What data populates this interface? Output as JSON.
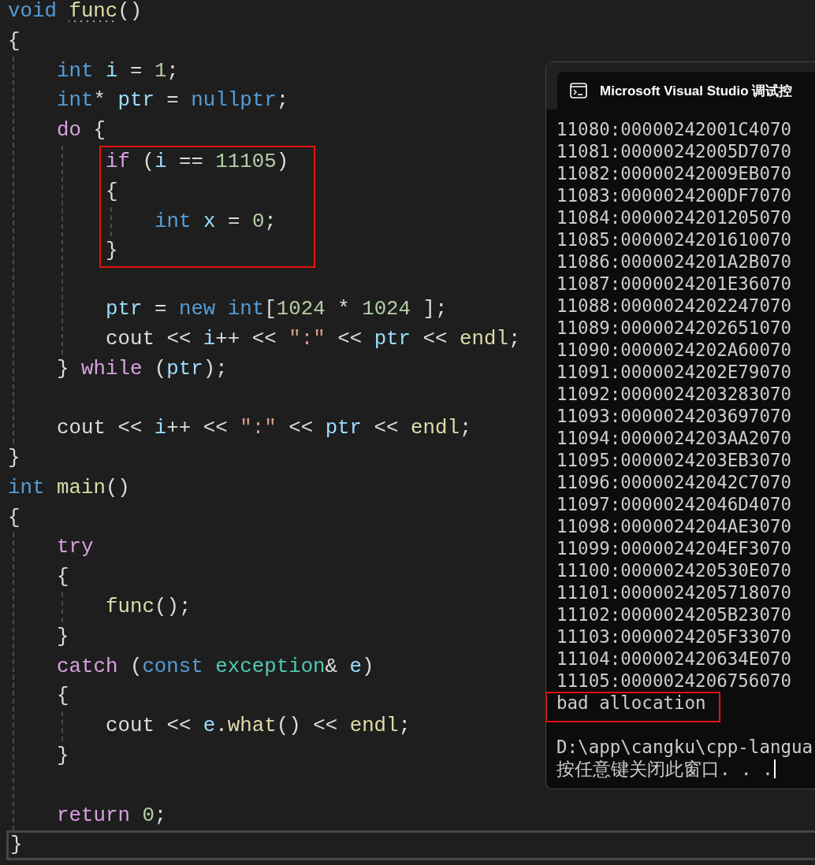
{
  "editor": {
    "lines": [
      {
        "kind": "line",
        "tokens": [
          {
            "text": "void ",
            "kind": "kw",
            "hint": false
          },
          {
            "text": "func",
            "kind": "fn",
            "hint": true
          },
          {
            "text": "()",
            "kind": "plain",
            "hint": false
          }
        ]
      },
      {
        "kind": "line",
        "tokens": [
          {
            "text": "{",
            "kind": "plain"
          }
        ],
        "children": [
          {
            "kind": "line",
            "tokens": [
              {
                "text": "int ",
                "kind": "kw"
              },
              {
                "text": "i",
                "kind": "var"
              },
              {
                "text": " = ",
                "kind": "plain"
              },
              {
                "text": "1",
                "kind": "num"
              },
              {
                "text": ";",
                "kind": "plain"
              }
            ]
          },
          {
            "kind": "line",
            "tokens": [
              {
                "text": "int",
                "kind": "kw"
              },
              {
                "text": "* ",
                "kind": "plain"
              },
              {
                "text": "ptr",
                "kind": "var"
              },
              {
                "text": " = ",
                "kind": "plain"
              },
              {
                "text": "nullptr",
                "kind": "kw"
              },
              {
                "text": ";",
                "kind": "plain"
              }
            ]
          },
          {
            "kind": "line",
            "tokens": [
              {
                "text": "do",
                "kind": "ctl"
              },
              {
                "text": " {",
                "kind": "plain"
              }
            ],
            "children": [
              {
                "kind": "box",
                "lines": [
                  {
                    "kind": "line",
                    "tokens": [
                      {
                        "text": "if",
                        "kind": "ctl"
                      },
                      {
                        "text": " (",
                        "kind": "plain"
                      },
                      {
                        "text": "i",
                        "kind": "var"
                      },
                      {
                        "text": " == ",
                        "kind": "plain"
                      },
                      {
                        "text": "11105",
                        "kind": "num"
                      },
                      {
                        "text": ")",
                        "kind": "plain"
                      }
                    ]
                  },
                  {
                    "kind": "line",
                    "tokens": [
                      {
                        "text": "{",
                        "kind": "plain"
                      }
                    ],
                    "children": [
                      {
                        "kind": "line",
                        "tokens": [
                          {
                            "text": "int ",
                            "kind": "kw"
                          },
                          {
                            "text": "x",
                            "kind": "var"
                          },
                          {
                            "text": " = ",
                            "kind": "plain"
                          },
                          {
                            "text": "0",
                            "kind": "num"
                          },
                          {
                            "text": ";",
                            "kind": "plain"
                          }
                        ]
                      }
                    ]
                  },
                  {
                    "kind": "line",
                    "tokens": [
                      {
                        "text": "}",
                        "kind": "plain"
                      }
                    ]
                  }
                ]
              },
              {
                "kind": "blank"
              },
              {
                "kind": "line",
                "tokens": [
                  {
                    "text": "ptr",
                    "kind": "var"
                  },
                  {
                    "text": " = ",
                    "kind": "plain"
                  },
                  {
                    "text": "new int",
                    "kind": "kw"
                  },
                  {
                    "text": "[",
                    "kind": "plain"
                  },
                  {
                    "text": "1024",
                    "kind": "num"
                  },
                  {
                    "text": " * ",
                    "kind": "plain"
                  },
                  {
                    "text": "1024",
                    "kind": "num"
                  },
                  {
                    "text": " ];",
                    "kind": "plain"
                  }
                ]
              },
              {
                "kind": "line",
                "tokens": [
                  {
                    "text": "cout << ",
                    "kind": "plain"
                  },
                  {
                    "text": "i",
                    "kind": "var"
                  },
                  {
                    "text": "++ << ",
                    "kind": "plain"
                  },
                  {
                    "text": "\":\"",
                    "kind": "str"
                  },
                  {
                    "text": " << ",
                    "kind": "plain"
                  },
                  {
                    "text": "ptr",
                    "kind": "var"
                  },
                  {
                    "text": " << ",
                    "kind": "plain"
                  },
                  {
                    "text": "endl",
                    "kind": "fn"
                  },
                  {
                    "text": ";",
                    "kind": "plain"
                  }
                ]
              }
            ]
          },
          {
            "kind": "line",
            "tokens": [
              {
                "text": "} ",
                "kind": "plain"
              },
              {
                "text": "while",
                "kind": "ctl"
              },
              {
                "text": " (",
                "kind": "plain"
              },
              {
                "text": "ptr",
                "kind": "var"
              },
              {
                "text": ");",
                "kind": "plain"
              }
            ]
          },
          {
            "kind": "blank"
          },
          {
            "kind": "line",
            "tokens": [
              {
                "text": "cout << ",
                "kind": "plain"
              },
              {
                "text": "i",
                "kind": "var"
              },
              {
                "text": "++ << ",
                "kind": "plain"
              },
              {
                "text": "\":\"",
                "kind": "str"
              },
              {
                "text": " << ",
                "kind": "plain"
              },
              {
                "text": "ptr",
                "kind": "var"
              },
              {
                "text": " << ",
                "kind": "plain"
              },
              {
                "text": "endl",
                "kind": "fn"
              },
              {
                "text": ";",
                "kind": "plain"
              }
            ]
          }
        ]
      },
      {
        "kind": "line",
        "tokens": [
          {
            "text": "}",
            "kind": "plain"
          }
        ]
      },
      {
        "kind": "line",
        "tokens": [
          {
            "text": "int ",
            "kind": "kw"
          },
          {
            "text": "main",
            "kind": "fn"
          },
          {
            "text": "()",
            "kind": "plain"
          }
        ]
      },
      {
        "kind": "line",
        "tokens": [
          {
            "text": "{",
            "kind": "plain"
          }
        ],
        "children": [
          {
            "kind": "line",
            "tokens": [
              {
                "text": "try",
                "kind": "ctl"
              }
            ]
          },
          {
            "kind": "line",
            "tokens": [
              {
                "text": "{",
                "kind": "plain"
              }
            ],
            "children": [
              {
                "kind": "line",
                "tokens": [
                  {
                    "text": "func",
                    "kind": "fn"
                  },
                  {
                    "text": "();",
                    "kind": "plain"
                  }
                ]
              }
            ]
          },
          {
            "kind": "line",
            "tokens": [
              {
                "text": "}",
                "kind": "plain"
              }
            ]
          },
          {
            "kind": "line",
            "tokens": [
              {
                "text": "catch",
                "kind": "ctl"
              },
              {
                "text": " (",
                "kind": "plain"
              },
              {
                "text": "const ",
                "kind": "kw"
              },
              {
                "text": "exception",
                "kind": "type"
              },
              {
                "text": "& ",
                "kind": "plain"
              },
              {
                "text": "e",
                "kind": "var"
              },
              {
                "text": ")",
                "kind": "plain"
              }
            ]
          },
          {
            "kind": "line",
            "tokens": [
              {
                "text": "{",
                "kind": "plain"
              }
            ],
            "children": [
              {
                "kind": "line",
                "tokens": [
                  {
                    "text": "cout << ",
                    "kind": "plain"
                  },
                  {
                    "text": "e",
                    "kind": "var"
                  },
                  {
                    "text": ".",
                    "kind": "plain"
                  },
                  {
                    "text": "what",
                    "kind": "fn"
                  },
                  {
                    "text": "() << ",
                    "kind": "plain"
                  },
                  {
                    "text": "endl",
                    "kind": "fn"
                  },
                  {
                    "text": ";",
                    "kind": "plain"
                  }
                ]
              }
            ]
          },
          {
            "kind": "line",
            "tokens": [
              {
                "text": "}",
                "kind": "plain"
              }
            ]
          },
          {
            "kind": "blank"
          },
          {
            "kind": "line",
            "tokens": [
              {
                "text": "return ",
                "kind": "ctl"
              },
              {
                "text": "0",
                "kind": "num"
              },
              {
                "text": ";",
                "kind": "plain"
              }
            ]
          }
        ]
      },
      {
        "kind": "current",
        "tokens": [
          {
            "text": "}",
            "kind": "plain"
          }
        ]
      }
    ]
  },
  "console": {
    "title": "Microsoft Visual Studio 调试控",
    "cursor": true,
    "lines": [
      {
        "kind": "text",
        "text": "11080:00000242001C4070"
      },
      {
        "kind": "text",
        "text": "11081:00000242005D7070"
      },
      {
        "kind": "text",
        "text": "11082:00000242009EB070"
      },
      {
        "kind": "text",
        "text": "11083:0000024200DF7070"
      },
      {
        "kind": "text",
        "text": "11084:0000024201205070"
      },
      {
        "kind": "text",
        "text": "11085:0000024201610070"
      },
      {
        "kind": "text",
        "text": "11086:0000024201A2B070"
      },
      {
        "kind": "text",
        "text": "11087:0000024201E36070"
      },
      {
        "kind": "text",
        "text": "11088:0000024202247070"
      },
      {
        "kind": "text",
        "text": "11089:0000024202651070"
      },
      {
        "kind": "text",
        "text": "11090:0000024202A60070"
      },
      {
        "kind": "text",
        "text": "11091:0000024202E79070"
      },
      {
        "kind": "text",
        "text": "11092:0000024203283070"
      },
      {
        "kind": "text",
        "text": "11093:0000024203697070"
      },
      {
        "kind": "text",
        "text": "11094:0000024203AA2070"
      },
      {
        "kind": "text",
        "text": "11095:0000024203EB3070"
      },
      {
        "kind": "text",
        "text": "11096:00000242042C7070"
      },
      {
        "kind": "text",
        "text": "11097:00000242046D4070"
      },
      {
        "kind": "text",
        "text": "11098:0000024204AE3070"
      },
      {
        "kind": "text",
        "text": "11099:0000024204EF3070"
      },
      {
        "kind": "text",
        "text": "11100:000002420530E070"
      },
      {
        "kind": "text",
        "text": "11101:0000024205718070"
      },
      {
        "kind": "text",
        "text": "11102:0000024205B23070"
      },
      {
        "kind": "text",
        "text": "11103:0000024205F33070"
      },
      {
        "kind": "text",
        "text": "11104:000002420634E070"
      },
      {
        "kind": "text",
        "text": "11105:0000024206756070"
      },
      {
        "kind": "boxed",
        "text": "bad allocation"
      },
      {
        "kind": "blank"
      },
      {
        "kind": "text",
        "text": "D:\\app\\cangku\\cpp-langua"
      },
      {
        "kind": "text",
        "text": "按任意键关闭此窗口. . ."
      }
    ]
  }
}
